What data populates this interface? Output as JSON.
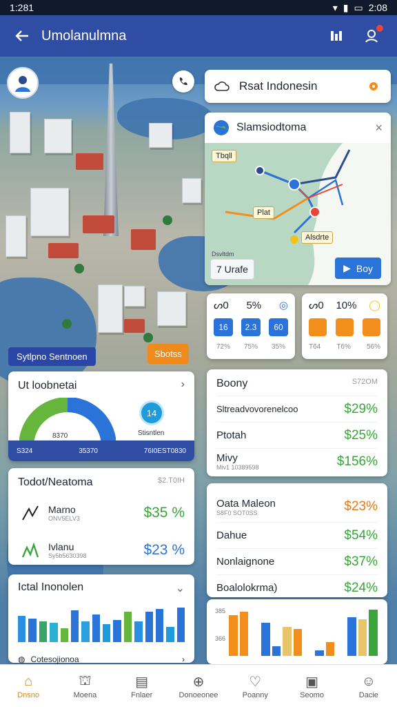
{
  "status": {
    "time": "1:281",
    "clock_right": "2:08"
  },
  "appbar": {
    "title": "Umolanulmna"
  },
  "search": {
    "label": "Rsat Indonesin"
  },
  "route": {
    "title": "Slamsiodtoma",
    "tags": [
      "Tbqll",
      "Plat",
      "Alsdrte"
    ],
    "info": "Dsvltdm",
    "eta_label": "7 Urafe",
    "action_label": "Boy"
  },
  "stats_left": {
    "items": [
      {
        "symbol": "ᔕ0",
        "value": "5%"
      }
    ],
    "chips": [
      "16",
      "2.3",
      "60"
    ],
    "foot": [
      "72%",
      "75%",
      "35%"
    ]
  },
  "stats_right": {
    "items": [
      {
        "symbol": "ᔕ0",
        "value": "10%"
      }
    ],
    "foot": [
      "T64",
      "T6%",
      "56%"
    ]
  },
  "map_labels": {
    "left": "Sytlpno Sentnoen",
    "button": "Sbotss"
  },
  "gauge": {
    "title": "Ut loobnetai",
    "center_label": "8370",
    "circle_value": "14",
    "circle_sub": "Stisntlen",
    "foot_left": "S324",
    "foot_mid": "35370",
    "foot_right": "76I0EST0830"
  },
  "left_metric": {
    "title": "Todot/Neatoma",
    "meta": "$2.T0IH",
    "rows": [
      {
        "label": "Marno",
        "sub": "ONV5ELV3",
        "value": "$35 %",
        "color": "#3aa53a"
      },
      {
        "label": "Ivlanu",
        "sub": "Sy5b5630398",
        "value": "$23 %",
        "color": "#2a73d8"
      }
    ]
  },
  "bar_card": {
    "title": "Ictal Inonolen",
    "footer": "Cotesojionoa",
    "values": [
      38,
      34,
      30,
      28,
      20,
      46,
      30,
      40,
      26,
      32,
      44,
      30,
      44,
      48,
      22,
      50
    ],
    "colors": [
      "#2a8fe0",
      "#2a73d8",
      "#3aa569",
      "#2ab0d0",
      "#66b53d",
      "#2a73d8",
      "#2aa0e0",
      "#2a73d8",
      "#1e9bdc",
      "#2a73d8",
      "#66b53d",
      "#2a8fe0",
      "#2a73d8",
      "#2a73d8",
      "#1e9bdc",
      "#2a73d8"
    ]
  },
  "right_metric_top": {
    "title": "Boony",
    "meta": "S72OM",
    "rows": [
      {
        "label": "Sltreadvovorenelcoo",
        "value": "$29%"
      },
      {
        "label": "Ptotah",
        "value": "$25%"
      },
      {
        "label": "Mivy",
        "sub": "Miv1 10389598",
        "value": "$156%"
      }
    ]
  },
  "right_metric_bottom": {
    "title": "Oata Maleon",
    "sub": "S8F0 SOT0SS",
    "rows": [
      {
        "label": "Dahue",
        "value": "$54%",
        "color": "#3aa53a"
      },
      {
        "label": "Nonlaignone",
        "value": "$37%",
        "color": "#3aa53a"
      },
      {
        "label": "Boalolokrma)",
        "value": "$24%",
        "color": "#3aa53a"
      }
    ],
    "first_value": "$23%"
  },
  "right_bars": {
    "axis": [
      "385",
      "366"
    ],
    "values": [
      42,
      46,
      0,
      34,
      10,
      30,
      28,
      0,
      6,
      14,
      0,
      40,
      38,
      48
    ],
    "colors": [
      "#f18e1c",
      "#f18e1c",
      "#fff",
      "#2a73d8",
      "#2a73d8",
      "#e8c46b",
      "#f18e1c",
      "#fff",
      "#2a73d8",
      "#f18e1c",
      "#fff",
      "#2a73d8",
      "#e8c46b",
      "#3aa53a"
    ]
  },
  "nav": [
    {
      "label": "Dnsno",
      "icon": "home-icon"
    },
    {
      "label": "Moena",
      "icon": "map-pin-icon"
    },
    {
      "label": "Fnlaer",
      "icon": "list-icon"
    },
    {
      "label": "Donoeonee",
      "icon": "compass-icon"
    },
    {
      "label": "Poanny",
      "icon": "heart-icon"
    },
    {
      "label": "Seomo",
      "icon": "calendar-icon"
    },
    {
      "label": "Dacie",
      "icon": "profile-icon"
    }
  ]
}
